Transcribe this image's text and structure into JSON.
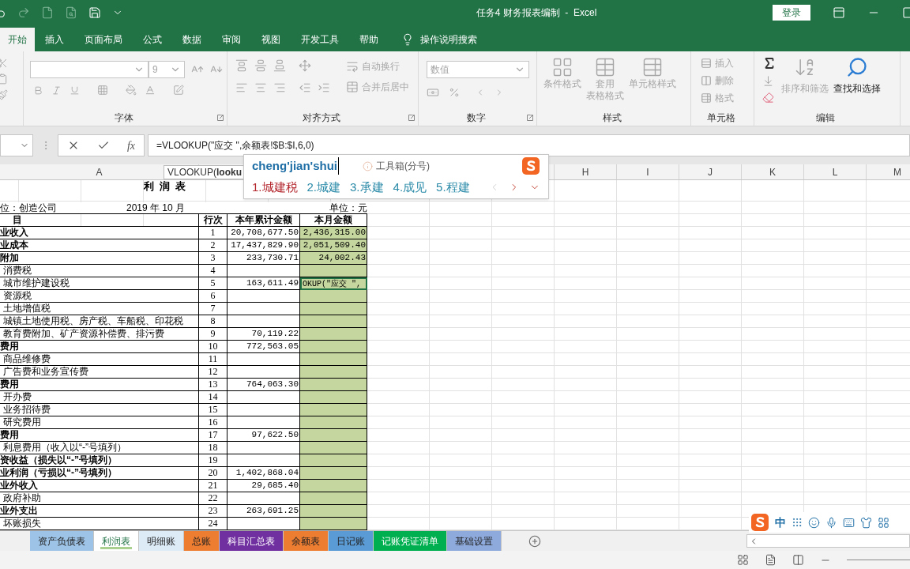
{
  "title_bar": {
    "title": "任务4 财务报表编制  -  Excel",
    "login": "登录"
  },
  "menu_tabs": [
    {
      "label": "开始",
      "selected": true
    },
    {
      "label": "插入",
      "selected": false
    },
    {
      "label": "页面布局",
      "selected": false
    },
    {
      "label": "公式",
      "selected": false
    },
    {
      "label": "数据",
      "selected": false
    },
    {
      "label": "审阅",
      "selected": false
    },
    {
      "label": "视图",
      "selected": false
    },
    {
      "label": "开发工具",
      "selected": false
    },
    {
      "label": "帮助",
      "selected": false
    }
  ],
  "tell_me": "操作说明搜索",
  "ribbon": {
    "font": {
      "label": "字体",
      "font_size": "9"
    },
    "alignment": {
      "label": "对齐方式",
      "wrap": "自动换行",
      "merge": "合并后居中"
    },
    "number": {
      "label": "数字",
      "format": "数值"
    },
    "styles": {
      "label": "样式",
      "buttons": [
        {
          "lines": [
            "条件格式"
          ],
          "disabled": true
        },
        {
          "lines": [
            "套用",
            "表格格式"
          ],
          "disabled": true
        },
        {
          "lines": [
            "单元格样式"
          ],
          "disabled": true
        }
      ]
    },
    "cells": {
      "label": "单元格",
      "buttons": [
        {
          "label": "插入",
          "disabled": true
        },
        {
          "label": "删除",
          "disabled": true
        },
        {
          "label": "格式",
          "disabled": true
        }
      ]
    },
    "editing": {
      "label": "编辑",
      "buttons": [
        {
          "label": "排序和筛选",
          "disabled": true
        },
        {
          "label": "查找和选择",
          "disabled": false
        }
      ]
    }
  },
  "formula_bar": {
    "function_button": "fx",
    "formula": "=VLOOKUP(\"应交 \",余额表!$B:$I,6,0)"
  },
  "tooltip": "VLOOKUP(**looku**",
  "ime": {
    "pinyin": "cheng'jian'shui",
    "hint": "工具箱(分号)",
    "candidates": [
      {
        "label": "1.城建税",
        "selected": true
      },
      {
        "label": "2.城建",
        "selected": false
      },
      {
        "label": "3.承建",
        "selected": false
      },
      {
        "label": "4.成见",
        "selected": false
      },
      {
        "label": "5.程建",
        "selected": false
      }
    ]
  },
  "columns": [
    {
      "label": "A"
    },
    {
      "label": "H"
    },
    {
      "label": "I"
    },
    {
      "label": "J"
    },
    {
      "label": "K"
    },
    {
      "label": "L"
    },
    {
      "label": "M"
    }
  ],
  "sheet": {
    "title": "利  润  表",
    "company": "位：创造公司",
    "period": "2019 年 10 月",
    "unit": "单位：元",
    "header": [
      "目",
      "行次",
      "本年累计金额",
      "本月金额"
    ],
    "rows": [
      {
        "item": "业收入",
        "kind": "total",
        "line": "1",
        "year": "20,708,677.50",
        "month": "2,436,315.00",
        "selected": false
      },
      {
        "item": "业成本",
        "kind": "total",
        "line": "2",
        "year": "17,437,829.90",
        "month": "2,051,509.40",
        "selected": false
      },
      {
        "item": "附加",
        "kind": "total",
        "line": "3",
        "year": "233,730.71",
        "month": "24,002.43",
        "selected": false
      },
      {
        "item": "消费税",
        "kind": "sub",
        "line": "4",
        "selected": false
      },
      {
        "item": "城市维护建设税",
        "kind": "sub",
        "line": "5",
        "year": "163,611.49",
        "month": "OKUP(\"应交 \",",
        "selected": true
      },
      {
        "item": "资源税",
        "kind": "sub",
        "line": "6",
        "selected": false
      },
      {
        "item": "土地增值税",
        "kind": "sub",
        "line": "7",
        "selected": false
      },
      {
        "item": "城镇土地使用税、房产税、车船税、印花税",
        "kind": "sub",
        "line": "8",
        "selected": false
      },
      {
        "item": "教育费附加、矿产资源补偿费、排污费",
        "kind": "sub",
        "line": "9",
        "year": "70,119.22",
        "selected": false
      },
      {
        "item": "费用",
        "kind": "total",
        "line": "10",
        "year": "772,563.05",
        "selected": false
      },
      {
        "item": "商品维修费",
        "kind": "sub",
        "line": "11",
        "selected": false
      },
      {
        "item": "广告费和业务宣传费",
        "kind": "sub",
        "line": "12",
        "selected": false
      },
      {
        "item": "费用",
        "kind": "total",
        "line": "13",
        "year": "764,063.30",
        "selected": false
      },
      {
        "item": "开办费",
        "kind": "sub",
        "line": "14",
        "selected": false
      },
      {
        "item": "业务招待费",
        "kind": "sub",
        "line": "15",
        "selected": false
      },
      {
        "item": "研究费用",
        "kind": "sub",
        "line": "16",
        "selected": false
      },
      {
        "item": "费用",
        "kind": "total",
        "line": "17",
        "year": "97,622.50",
        "selected": false
      },
      {
        "item": "利息费用（收入以“-”号填列）",
        "kind": "sub",
        "line": "18",
        "selected": false
      },
      {
        "item": "资收益（损失以“-”号填列）",
        "kind": "total",
        "line": "19",
        "selected": false
      },
      {
        "item": "业利润（亏损以“-”号填列）",
        "kind": "total",
        "line": "20",
        "year": "1,402,868.04",
        "selected": false
      },
      {
        "item": "业外收入",
        "kind": "total",
        "line": "21",
        "year": "29,685.40",
        "selected": false
      },
      {
        "item": "政府补助",
        "kind": "sub",
        "line": "22",
        "selected": false
      },
      {
        "item": "业外支出",
        "kind": "total",
        "line": "23",
        "year": "263,691.25",
        "selected": false
      },
      {
        "item": "坏账损失",
        "kind": "sub",
        "line": "24",
        "selected": false
      }
    ]
  },
  "sheet_tabs": [
    {
      "label": "资产负债表",
      "color": "#9dc3e6",
      "selected": false
    },
    {
      "label": "利润表",
      "color": "#a9d08e",
      "selected": true
    },
    {
      "label": "明细账",
      "color": "#ddebf7",
      "selected": false
    },
    {
      "label": "总账",
      "color": "#ed7d31",
      "selected": false
    },
    {
      "label": "科目汇总表",
      "color": "#7030a0",
      "selected": false
    },
    {
      "label": "余额表",
      "color": "#ed7d31",
      "selected": false
    },
    {
      "label": "日记账",
      "color": "#5b9bd5",
      "selected": false
    },
    {
      "label": "记账凭证清单",
      "color": "#00b050",
      "selected": false
    },
    {
      "label": "基础设置",
      "color": "#8ea9db",
      "selected": false
    }
  ],
  "ime_toolbar": {
    "mode": "中"
  }
}
